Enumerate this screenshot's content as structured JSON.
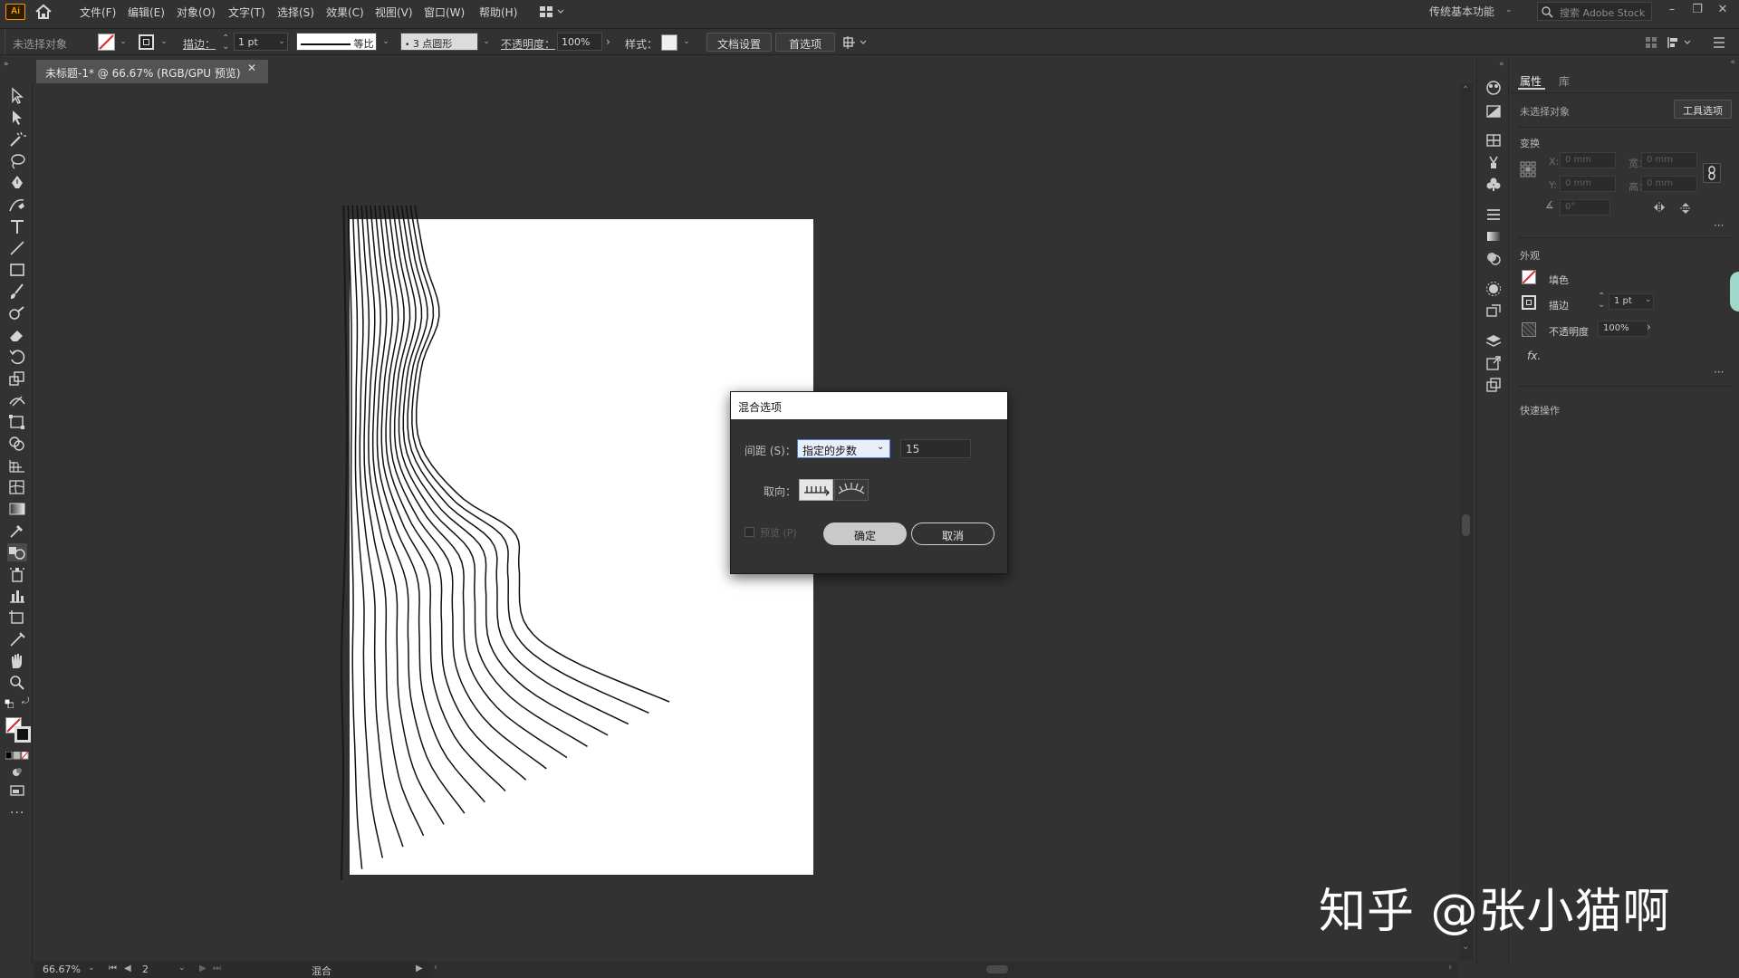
{
  "app": {
    "logo_text": "Ai",
    "menus": [
      "文件(F)",
      "编辑(E)",
      "对象(O)",
      "文字(T)",
      "选择(S)",
      "效果(C)",
      "视图(V)",
      "窗口(W)",
      "帮助(H)"
    ],
    "workspace": "传统基本功能",
    "search_placeholder": "搜索 Adobe Stock"
  },
  "control_bar": {
    "selection_state": "未选择对象",
    "stroke_label": "描边：",
    "stroke_weight": "1 pt",
    "stroke_profile": "等比",
    "brush": "3 点圆形",
    "opacity_label": "不透明度：",
    "opacity_value": "100%",
    "style_label": "样式：",
    "doc_setup_button": "文档设置",
    "preferences_button": "首选项"
  },
  "document": {
    "tab_title": "未标题-1* @ 66.67% (RGB/GPU 预览)"
  },
  "properties_panel": {
    "tab_properties": "属性",
    "tab_libraries": "库",
    "no_selection": "未选择对象",
    "tool_options_button": "工具选项",
    "transform_title": "变换",
    "x_label": "X:",
    "y_label": "Y:",
    "w_label": "宽：",
    "h_label": "高：",
    "x_value": "0 mm",
    "y_value": "0 mm",
    "w_value": "0 mm",
    "h_value": "0 mm",
    "angle_value": "0°",
    "appearance_title": "外观",
    "fill_label": "填色",
    "stroke_label": "描边",
    "stroke_value": "1 pt",
    "opacity_label": "不透明度",
    "opacity_value": "100%",
    "fx_label": "fx.",
    "quick_actions_title": "快速操作"
  },
  "dialog": {
    "title": "混合选项",
    "spacing_label": "间距 (S)：",
    "spacing_option": "指定的步数",
    "steps_value": "15",
    "orientation_label": "取向：",
    "preview_label": "预览 (P)",
    "preview_checked": false,
    "ok_button": "确定",
    "cancel_button": "取消"
  },
  "status_bar": {
    "zoom": "66.67%",
    "artboard_number": "2",
    "tool_name": "混合"
  },
  "watermark": "知乎 @张小猫啊",
  "colors": {
    "ui_background": "#323232",
    "artboard": "#ffffff",
    "dialog_title_bar": "#ffffff",
    "selected_dropdown": "#e9eefb",
    "accent_blue": "#4a7bd8",
    "none_swatch_red": "#e0262b"
  }
}
